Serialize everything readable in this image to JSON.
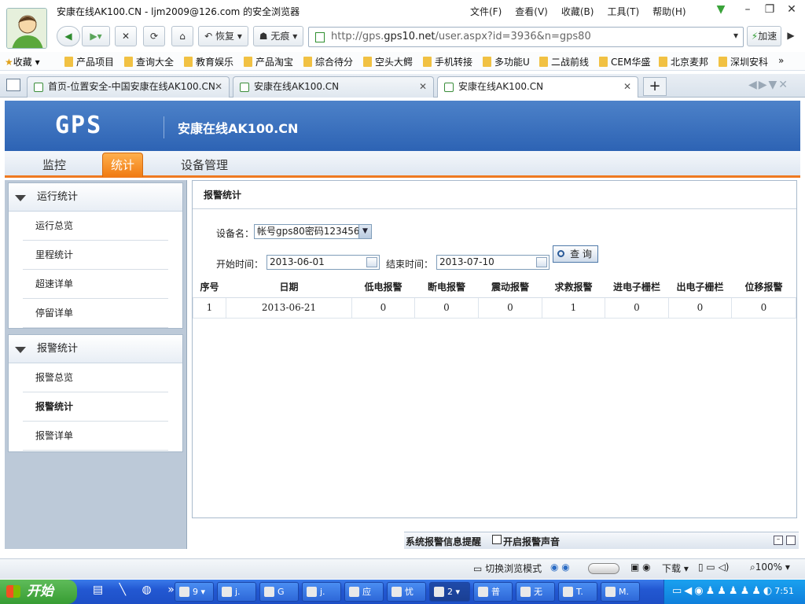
{
  "browser": {
    "window_title": "安康在线AK100.CN - ljm2009@126.com 的安全浏览器",
    "menu": [
      "文件(F)",
      "查看(V)",
      "收藏(B)",
      "工具(T)",
      "帮助(H)"
    ],
    "restore_label": "恢复",
    "noscript_label": "无痕",
    "url_prefix": "http://gps.",
    "url_domain": "gps10.net",
    "url_suffix": "/user.aspx?id=3936&n=gps80",
    "accelerate_label": "加速",
    "favorites_label": "收藏",
    "favorites": [
      "产品项目",
      "查询大全",
      "教育娱乐",
      "产品淘宝",
      "综合待分",
      "空头大鳄",
      "手机转接",
      "多功能U",
      "二战前线",
      "CEM华盛",
      "北京麦邦",
      "深圳安科"
    ],
    "tabs": [
      {
        "label": "首页-位置安全-中国安康在线AK100.CN"
      },
      {
        "label": "安康在线AK100.CN"
      },
      {
        "label": "安康在线AK100.CN"
      }
    ]
  },
  "site": {
    "logo": "GPS",
    "title": "安康在线AK100.CN",
    "nav": [
      "监控",
      "统计",
      "设备管理"
    ],
    "active_nav": "统计"
  },
  "sidebar": {
    "groups": [
      {
        "title": "运行统计",
        "items": [
          "运行总览",
          "里程统计",
          "超速详单",
          "停留详单"
        ]
      },
      {
        "title": "报警统计",
        "items": [
          "报警总览",
          "报警统计",
          "报警详单"
        ]
      }
    ],
    "active_item": "报警统计"
  },
  "main": {
    "heading": "报警统计",
    "device_label": "设备名：",
    "device_value": "帐号gps80密码123456",
    "start_label": "开始时间：",
    "start_value": "2013-06-01",
    "end_label": "结束时间：",
    "end_value": "2013-07-10",
    "query_label": "查 询",
    "table": {
      "columns": [
        "序号",
        "日期",
        "低电报警",
        "断电报警",
        "震动报警",
        "求救报警",
        "进电子栅栏",
        "出电子栅栏",
        "位移报警"
      ],
      "rows": [
        [
          "1",
          "2013-06-21",
          "0",
          "0",
          "0",
          "1",
          "0",
          "0",
          "0"
        ]
      ]
    }
  },
  "alertbar": {
    "title": "系统报警信息提醒",
    "sound_label": "开启报警声音"
  },
  "statusbar": {
    "mode_label": "切换浏览模式",
    "download_label": "下载",
    "zoom": "100%"
  },
  "taskbar": {
    "start_label": "开始",
    "tasks": [
      "9",
      "j.",
      "G",
      "j.",
      "应",
      "忧",
      "2",
      "普",
      "无",
      "T.",
      "M."
    ],
    "clock": "7:51"
  }
}
